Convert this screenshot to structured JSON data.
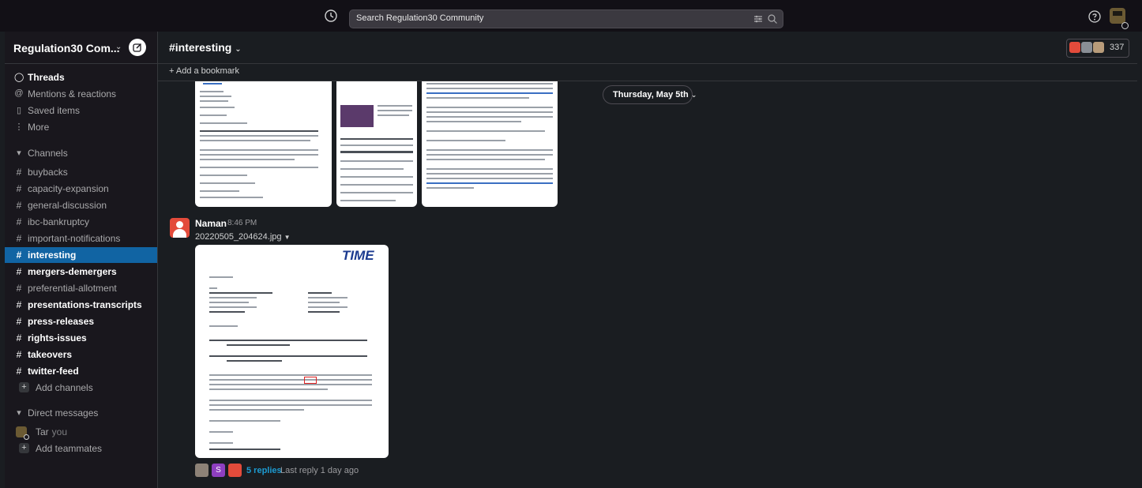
{
  "topbar": {
    "search_placeholder": "Search Regulation30 Community"
  },
  "sidebar": {
    "workspace_name": "Regulation30 Com...",
    "nav": [
      {
        "label": "Threads",
        "icon": "threads-icon"
      },
      {
        "label": "Mentions & reactions",
        "icon": "at-icon"
      },
      {
        "label": "Saved items",
        "icon": "bookmark-icon"
      },
      {
        "label": "More",
        "icon": "more-icon"
      }
    ],
    "channels_heading": "Channels",
    "channels": [
      {
        "name": "buybacks",
        "state": "normal"
      },
      {
        "name": "capacity-expansion",
        "state": "normal"
      },
      {
        "name": "general-discussion",
        "state": "normal"
      },
      {
        "name": "ibc-bankruptcy",
        "state": "normal"
      },
      {
        "name": "important-notifications",
        "state": "normal"
      },
      {
        "name": "interesting",
        "state": "active"
      },
      {
        "name": "mergers-demergers",
        "state": "unread"
      },
      {
        "name": "preferential-allotment",
        "state": "normal"
      },
      {
        "name": "presentations-transcripts",
        "state": "unread"
      },
      {
        "name": "press-releases",
        "state": "unread"
      },
      {
        "name": "rights-issues",
        "state": "unread"
      },
      {
        "name": "takeovers",
        "state": "unread"
      },
      {
        "name": "twitter-feed",
        "state": "unread"
      }
    ],
    "add_channels": "Add channels",
    "dm_heading": "Direct messages",
    "dm_user": "Tar",
    "dm_you": "you",
    "add_teammates": "Add teammates"
  },
  "channel": {
    "title": "#interesting",
    "member_count": "337",
    "add_bookmark": "+ Add a bookmark",
    "date_divider": "Thursday, May 5th"
  },
  "message": {
    "author": "Naman",
    "time": "8:46 PM",
    "file_name": "20220505_204624.jpg",
    "doc_logo": "TIME",
    "replies_count": "5 replies",
    "last_reply": "Last reply 1 day ago",
    "reply_avatar_letter": "S"
  },
  "colors": {
    "active_channel": "#1164a3",
    "link": "#1d9bd1",
    "avatar_red": "#e34b3b"
  }
}
